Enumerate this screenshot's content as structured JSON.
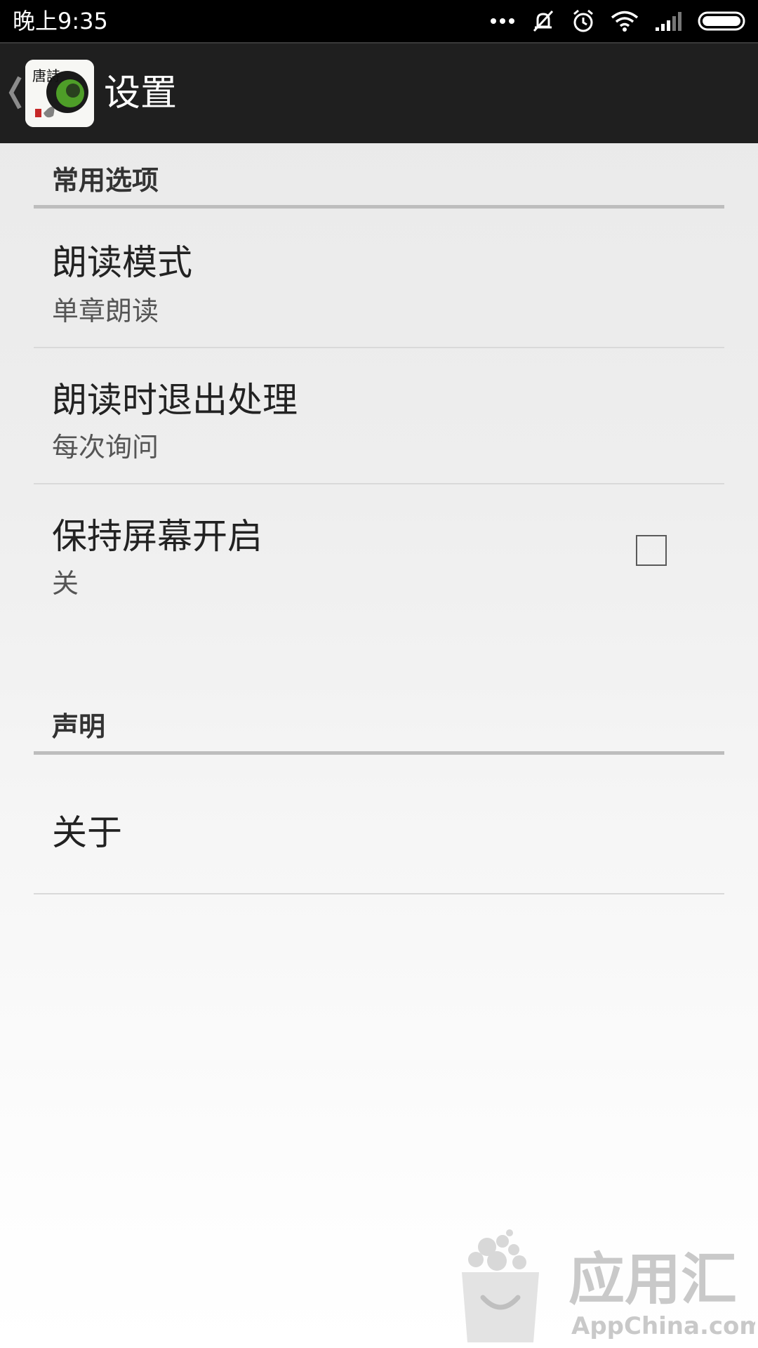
{
  "status_bar": {
    "time": "晚上9:35",
    "icons": [
      "more-dots-icon",
      "vibrate-off-icon",
      "alarm-icon",
      "wifi-icon",
      "signal-icon",
      "battery-icon"
    ]
  },
  "action_bar": {
    "back_icon": "chevron-left-icon",
    "logo_text": "唐詩",
    "title": "设置"
  },
  "sections": [
    {
      "header": "常用选项",
      "items": [
        {
          "title": "朗读模式",
          "summary": "单章朗读"
        },
        {
          "title": "朗读时退出处理",
          "summary": "每次询问"
        },
        {
          "title": "保持屏幕开启",
          "summary": "关",
          "checkbox": {
            "checked": false
          }
        }
      ]
    },
    {
      "header": "声明",
      "items": [
        {
          "title": "关于"
        }
      ]
    }
  ],
  "watermark": {
    "brand_cn": "应用汇",
    "brand_en": "AppChina.com"
  },
  "colors": {
    "status_bar_bg": "#000000",
    "action_bar_bg": "#1f1f1f",
    "page_bg": "#eeeeee",
    "divider": "#bdbdbd"
  }
}
